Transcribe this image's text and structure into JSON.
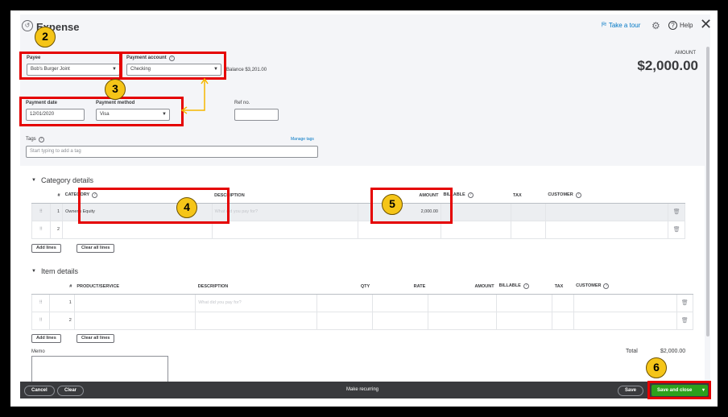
{
  "window": {
    "title": "Expense",
    "tour_label": "Take a tour",
    "help_label": "Help"
  },
  "amount": {
    "label": "AMOUNT",
    "value": "$2,000.00"
  },
  "payee": {
    "label": "Payee",
    "value": "Bob's Burger Joint"
  },
  "payment_account": {
    "label": "Payment account",
    "value": "Checking",
    "balance": "Balance $3,201.00"
  },
  "payment_date": {
    "label": "Payment date",
    "value": "12/01/2020"
  },
  "payment_method": {
    "label": "Payment method",
    "value": "Visa"
  },
  "ref_no": {
    "label": "Ref no.",
    "value": ""
  },
  "tags": {
    "label": "Tags",
    "placeholder": "Start typing to add a tag",
    "manage_label": "Manage tags"
  },
  "category_details": {
    "title": "Category details",
    "headers": {
      "num": "#",
      "category": "CATEGORY",
      "description": "DESCRIPTION",
      "amount": "AMOUNT",
      "billable": "BILLABLE",
      "tax": "TAX",
      "customer": "CUSTOMER"
    },
    "rows": [
      {
        "num": "1",
        "category": "Owner's Equity",
        "description": "What did you pay for?",
        "amount": "2,000.00"
      },
      {
        "num": "2",
        "category": "",
        "description": "",
        "amount": ""
      }
    ],
    "add_lines": "Add lines",
    "clear_lines": "Clear all lines"
  },
  "item_details": {
    "title": "Item details",
    "headers": {
      "num": "#",
      "product": "PRODUCT/SERVICE",
      "description": "DESCRIPTION",
      "qty": "QTY",
      "rate": "RATE",
      "amount": "AMOUNT",
      "billable": "BILLABLE",
      "tax": "TAX",
      "customer": "CUSTOMER"
    },
    "rows": [
      {
        "num": "1",
        "description": "What did you pay for?"
      },
      {
        "num": "2",
        "description": ""
      }
    ],
    "add_lines": "Add lines",
    "clear_lines": "Clear all lines"
  },
  "memo": {
    "label": "Memo"
  },
  "total": {
    "label": "Total",
    "value": "$2,000.00"
  },
  "footer": {
    "cancel": "Cancel",
    "clear": "Clear",
    "recurring": "Make recurring",
    "save": "Save",
    "save_close": "Save and close"
  },
  "annotations": {
    "b2": "2",
    "b3": "3",
    "b4": "4",
    "b5": "5",
    "b6": "6"
  },
  "colors": {
    "highlight": "#e50000",
    "badge": "#f5c518",
    "save_green": "#2ca01c",
    "arrow": "#f5b700"
  }
}
